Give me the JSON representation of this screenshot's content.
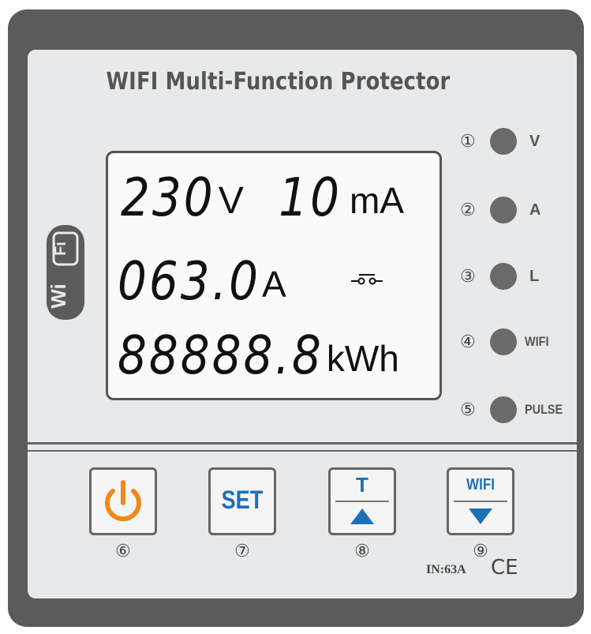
{
  "device": {
    "title": "WIFI Multi-Function Protector",
    "badge": {
      "left": "Wi",
      "right": "Fi"
    }
  },
  "lcd": {
    "line1": {
      "value_a": "230",
      "unit_a": "V",
      "value_b": "10",
      "unit_b": "mA"
    },
    "line2": {
      "value": "063.0",
      "unit": "A",
      "icon": "relay-switch-icon"
    },
    "line3": {
      "value": "88888.8",
      "unit": "kWh"
    }
  },
  "indicators": [
    {
      "num": "①",
      "label": "V"
    },
    {
      "num": "②",
      "label": "A"
    },
    {
      "num": "③",
      "label": "L"
    },
    {
      "num": "④",
      "label": "WIFI"
    },
    {
      "num": "⑤",
      "label": "PULSE"
    }
  ],
  "buttons": [
    {
      "num": "⑥",
      "label": "",
      "icon": "power-icon"
    },
    {
      "num": "⑦",
      "label": "SET",
      "icon": ""
    },
    {
      "num": "⑧",
      "label": "T",
      "icon": "up-triangle-icon"
    },
    {
      "num": "⑨",
      "label": "WIFI",
      "icon": "down-triangle-icon"
    }
  ],
  "certification": {
    "rating": "IN:63A",
    "mark": "CE"
  },
  "colors": {
    "frame": "#5b5b5b",
    "panel": "#e7e9eb",
    "power": "#ee8a1a",
    "blue": "#1d6fb8",
    "led": "#6a6a6a"
  }
}
